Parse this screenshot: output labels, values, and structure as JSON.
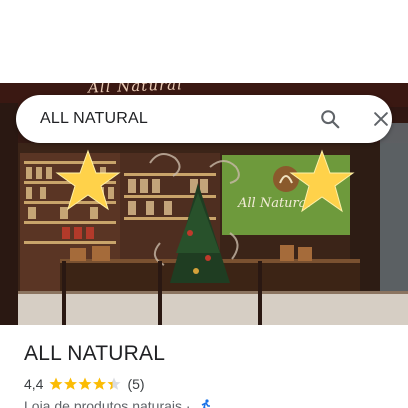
{
  "search": {
    "query": "ALL NATURAL"
  },
  "photo": {
    "sign_text": "All Natural",
    "wall_text": "All Natural"
  },
  "place": {
    "title": "ALL NATURAL",
    "rating": "4,4",
    "stars": 4.4,
    "star_color": "#fbbc04",
    "review_count": "(5)",
    "category": "Loja de produtos naturais ·"
  },
  "icons": {
    "search": "search-icon",
    "close": "close-icon",
    "delivery": "delivery-icon"
  }
}
